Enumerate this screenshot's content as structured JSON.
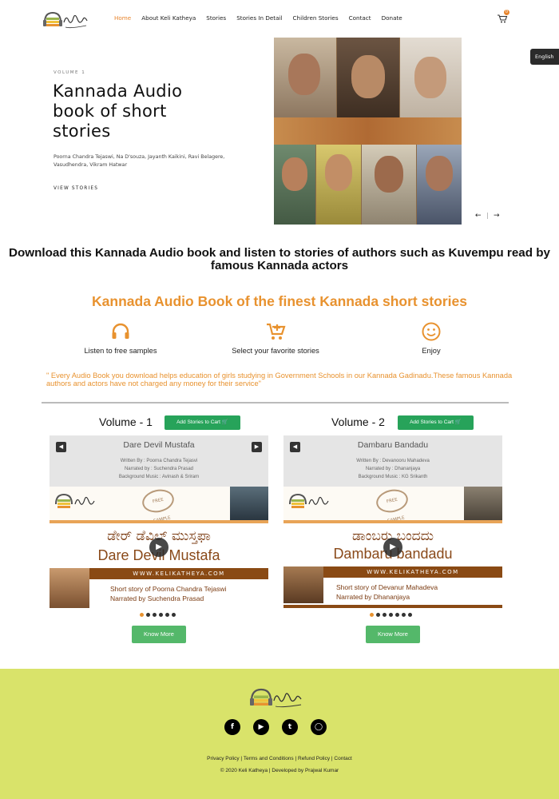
{
  "header": {
    "logo_text": "Keli Katheya",
    "nav": [
      {
        "label": "Home",
        "active": true
      },
      {
        "label": "About Keli Katheya",
        "active": false
      },
      {
        "label": "Stories",
        "active": false
      },
      {
        "label": "Stories In Detail",
        "active": false
      },
      {
        "label": "Children Stories",
        "active": false
      },
      {
        "label": "Contact",
        "active": false
      },
      {
        "label": "Donate",
        "active": false
      }
    ],
    "cart_count": "0",
    "language": "English"
  },
  "hero": {
    "volume_label": "VOLUME 1",
    "title": "Kannada Audio book of short stories",
    "authors": "Poorna Chandra Tejaswi, Na D'souza, Jayanth Kaikini, Ravi Belagere, Vasudhendra, Vikram Hatwar",
    "link": "VIEW STORIES",
    "prev_icon": "arrow-left-icon",
    "next_icon": "arrow-right-icon"
  },
  "intro": {
    "headline": "Download this Kannada Audio book and listen to stories of authors such as Kuvempu read by famous Kannada actors",
    "subhead": "Kannada Audio Book of the finest Kannada short stories",
    "features": [
      {
        "icon": "headphones-icon",
        "label": "Listen to free samples"
      },
      {
        "icon": "cart-plus-icon",
        "label": "Select your favorite stories"
      },
      {
        "icon": "smile-icon",
        "label": "Enjoy"
      }
    ],
    "note": "\" Every Audio Book you download helps education of girls studying in Government Schools in our Kannada Gadinadu.These famous Kannada authors and actors have not charged any money for their service\""
  },
  "volumes": [
    {
      "title": "Volume - 1",
      "add_button": "Add Stories to Cart",
      "player_title": "Dare Devil Mustafa",
      "written_by": "Written By : Poorna Chandra Tejasvi",
      "narrated_by": "Narrated by : Suchendra Prasad",
      "music": "Background Music : Avinash & Sriram",
      "poster_kannada": "ಡೇರ್ ಡೆವಿಲ್ ಮುಸ್ತಫಾ",
      "poster_english": "Dare Devil Mustafa",
      "poster_url": "WWW.KELIKATHEYA.COM",
      "poster_desc_1": "Short story of Poorna Chandra Tejaswi",
      "poster_desc_2": "Narrated by Suchendra Prasad",
      "free_sample": "FREE SAMPLE",
      "know_more": "Know More",
      "dots": 6
    },
    {
      "title": "Volume - 2",
      "add_button": "Add Stories to Cart",
      "player_title": "Dambaru Bandadu",
      "written_by": "Written By : Devanooru Mahadeva",
      "narrated_by": "Narrated by : Dhananjaya",
      "music": "Background Music : KG Srikanth",
      "poster_kannada": "ಡಾಂಬರು ಬಂದದು",
      "poster_english": "Dambaru bandadu",
      "poster_url": "WWW.KELIKATHEYA.COM",
      "poster_desc_1": "Short story of Devanur Mahadeva",
      "poster_desc_2": "Narrated by Dhananjaya",
      "free_sample": "FREE SAMPLE",
      "know_more": "Know More",
      "dots": 7
    }
  ],
  "footer": {
    "social": [
      "facebook-icon",
      "youtube-icon",
      "twitter-icon",
      "instagram-icon"
    ],
    "links": [
      "Privacy Policy",
      "Terms and Conditions",
      "Refund Policy",
      "Contact"
    ],
    "copyright": "© 2020 Keli Katheya | Developed by Prajwal Kumar"
  },
  "colors": {
    "accent": "#e8922f",
    "button_green": "#27a35a",
    "footer_bg": "#d9e36a"
  }
}
